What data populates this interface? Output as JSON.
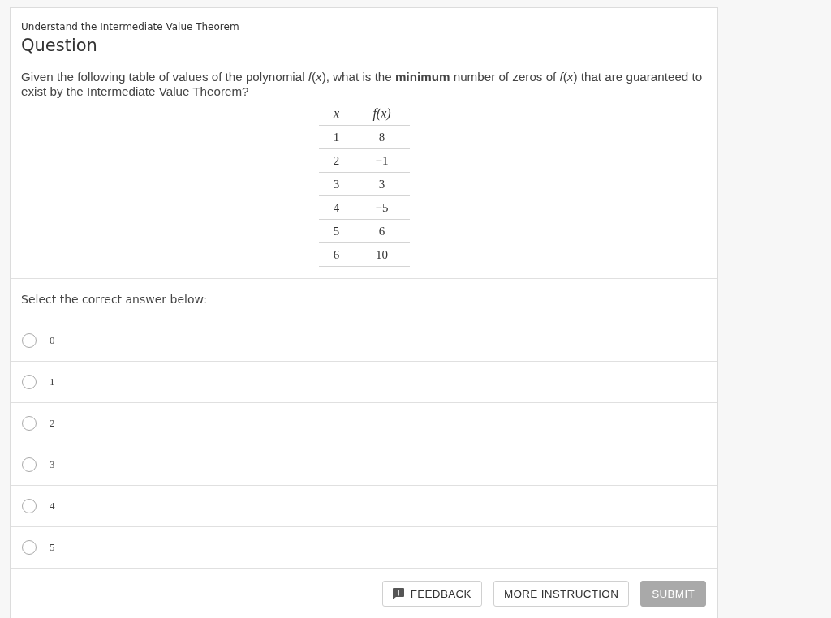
{
  "topic": "Understand the Intermediate Value Theorem",
  "heading": "Question",
  "question": "Given the following table of values of the polynomial *f*(*x*), what is the **minimum** number of zeros of *f*(*x*) that are guaranteed to exist by the Intermediate Value Theorem?",
  "table": {
    "columns": [
      "x",
      "f(x)"
    ],
    "rows": [
      [
        "1",
        "8"
      ],
      [
        "2",
        "−1"
      ],
      [
        "3",
        "3"
      ],
      [
        "4",
        "−5"
      ],
      [
        "5",
        "6"
      ],
      [
        "6",
        "10"
      ]
    ]
  },
  "prompt": "Select the correct answer below:",
  "options": [
    {
      "label": "0",
      "selected": false
    },
    {
      "label": "1",
      "selected": false
    },
    {
      "label": "2",
      "selected": false
    },
    {
      "label": "3",
      "selected": false
    },
    {
      "label": "4",
      "selected": false
    },
    {
      "label": "5",
      "selected": false
    }
  ],
  "buttons": [
    {
      "kind": "feedback",
      "label": "FEEDBACK",
      "disabled": false
    },
    {
      "kind": "instruction",
      "label": "MORE INSTRUCTION",
      "disabled": false
    },
    {
      "kind": "submit",
      "label": "SUBMIT",
      "disabled": true
    }
  ]
}
